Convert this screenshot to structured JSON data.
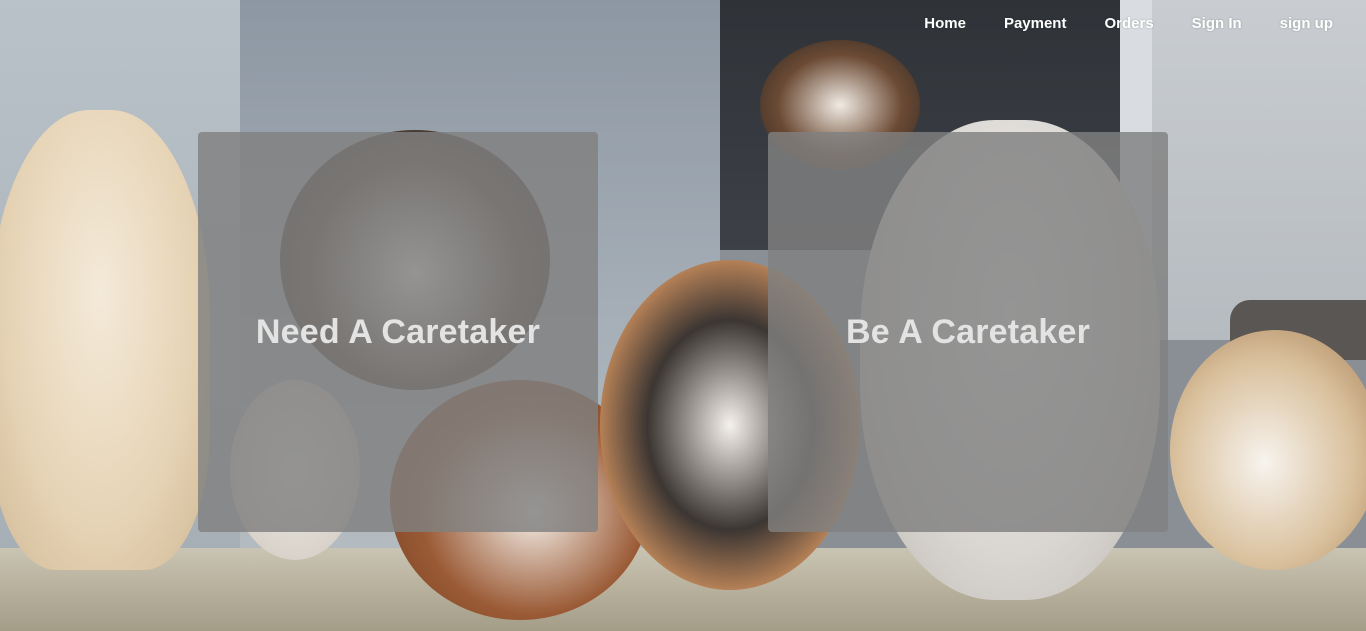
{
  "nav": {
    "items": [
      {
        "label": "Home"
      },
      {
        "label": "Payment"
      },
      {
        "label": "Orders"
      },
      {
        "label": "Sign In"
      },
      {
        "label": "sign up"
      }
    ]
  },
  "cards": {
    "need": {
      "title": "Need A Caretaker"
    },
    "be": {
      "title": "Be A Caretaker"
    }
  },
  "colors": {
    "nav_text": "#ffffff",
    "card_overlay": "#808080",
    "card_text": "#e3e3e3"
  }
}
